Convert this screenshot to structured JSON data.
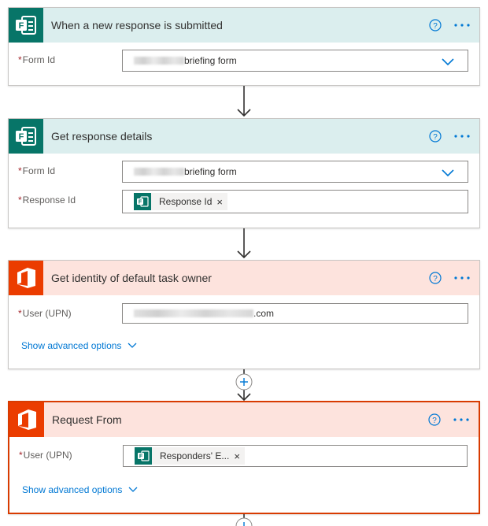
{
  "cards": [
    {
      "title": "When a new response is submitted",
      "fields": [
        {
          "label": "Form Id",
          "value": "briefing form"
        }
      ]
    },
    {
      "title": "Get response details",
      "fields": [
        {
          "label": "Form Id",
          "value": "briefing form"
        },
        {
          "label": "Response Id",
          "token": "Response Id"
        }
      ]
    },
    {
      "title": "Get identity of default task owner",
      "fields": [
        {
          "label": "User (UPN)",
          "value": ".com"
        }
      ],
      "advanced": "Show advanced options"
    },
    {
      "title": "Request From",
      "fields": [
        {
          "label": "User (UPN)",
          "token": "Responders' E..."
        }
      ],
      "advanced": "Show advanced options"
    }
  ],
  "required_marker": "*",
  "token_remove_glyph": "×",
  "colors": {
    "forms_header": "#dbeeee",
    "forms_icon": "#077568",
    "office_header": "#fde3dd",
    "office_icon": "#eb3c00",
    "selected_border": "#d83b01",
    "link": "#0078d4",
    "required": "#a4262c"
  },
  "icons": {
    "forms": "microsoft-forms-icon",
    "office": "office-icon",
    "help": "help-circle-icon",
    "more": "more-options-icon",
    "chevron": "chevron-down-icon",
    "add": "add-step-icon"
  }
}
